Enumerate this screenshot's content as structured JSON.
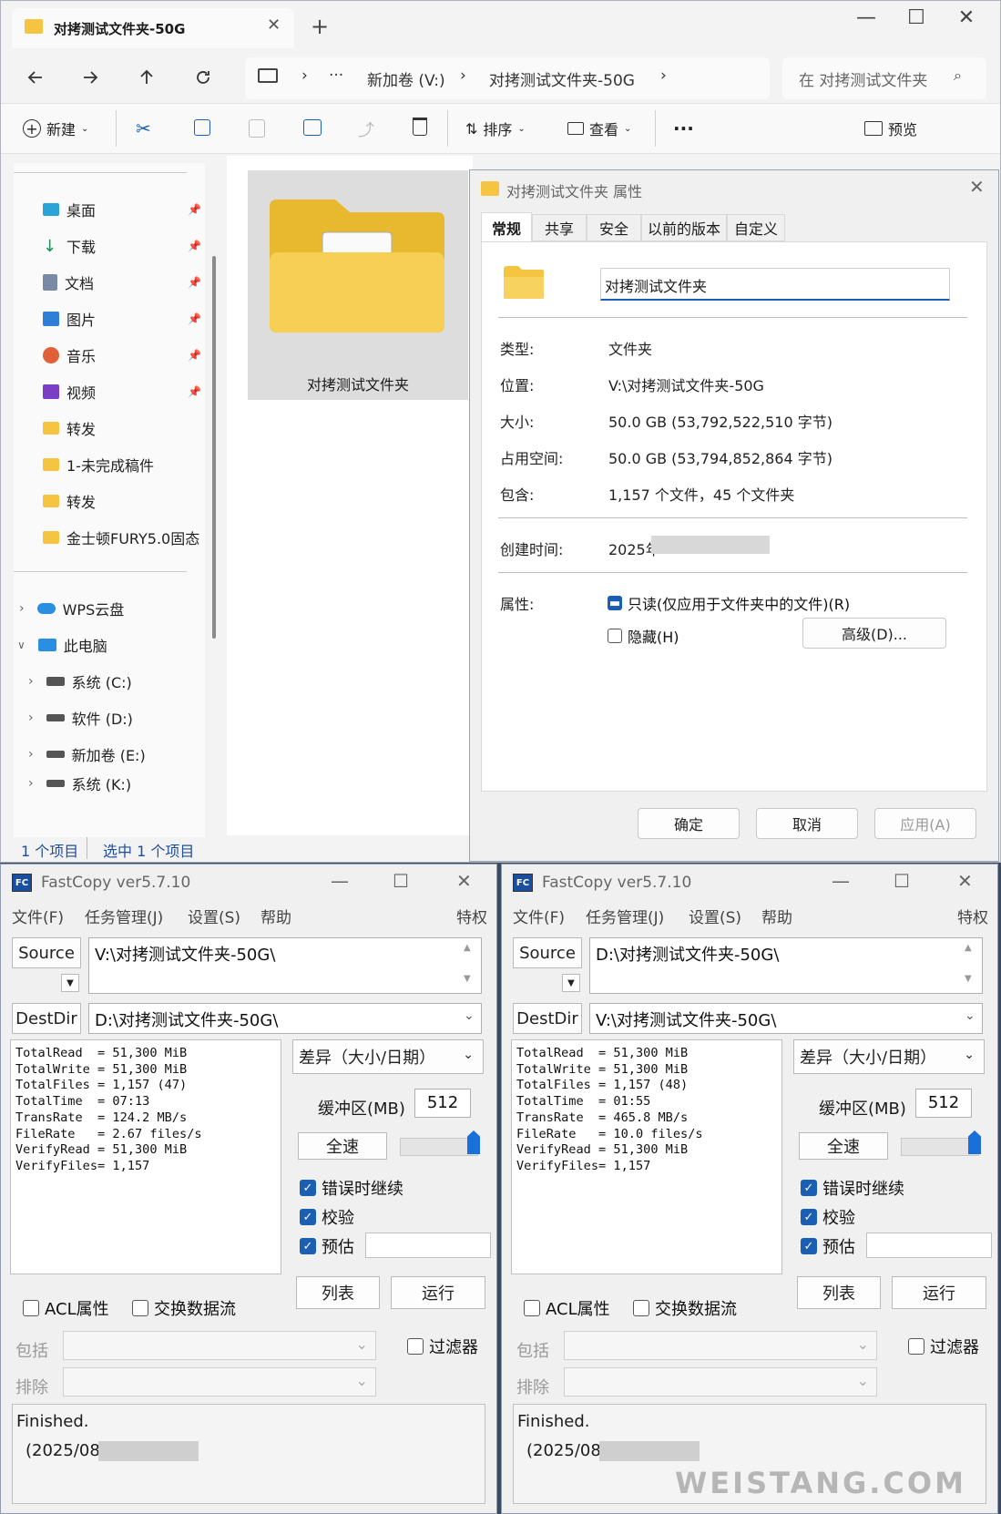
{
  "explorer": {
    "tab_title": "对拷测试文件夹-50G",
    "new_tab": "+",
    "window_controls": {
      "minimize": "—",
      "maximize": "☐",
      "close": "✕"
    },
    "breadcrumb": {
      "more": "···",
      "drive": "新加卷 (V:)",
      "folder": "对拷测试文件夹-50G"
    },
    "search_placeholder": "在 对拷测试文件夹",
    "toolbar": {
      "new": "新建",
      "sort": "排序",
      "view": "查看",
      "more": "···",
      "preview": "预览"
    },
    "sidebar": {
      "items": [
        "桌面",
        "下载",
        "文档",
        "图片",
        "音乐",
        "视频",
        "转发",
        "1-未完成稿件",
        "转发",
        "金士顿FURY5.0固态"
      ],
      "tree": [
        "WPS云盘",
        "此电脑",
        "系统 (C:)",
        "软件 (D:)",
        "新加卷 (E:)",
        "系统 (K:)"
      ]
    },
    "folder_item": "对拷测试文件夹",
    "status": {
      "count": "1 个项目",
      "selected": "选中 1 个项目"
    }
  },
  "properties": {
    "title": "对拷测试文件夹 属性",
    "tabs": [
      "常规",
      "共享",
      "安全",
      "以前的版本",
      "自定义"
    ],
    "name": "对拷测试文件夹",
    "rows": [
      {
        "label": "类型:",
        "value": "文件夹"
      },
      {
        "label": "位置:",
        "value": "V:\\对拷测试文件夹-50G"
      },
      {
        "label": "大小:",
        "value": "50.0 GB (53,792,522,510 字节)"
      },
      {
        "label": "占用空间:",
        "value": "50.0 GB (53,794,852,864 字节)"
      },
      {
        "label": "包含:",
        "value": "1,157 个文件，45 个文件夹"
      }
    ],
    "created_label": "创建时间:",
    "created_value": "2025年",
    "attr_label": "属性:",
    "readonly": "只读(仅应用于文件夹中的文件)(R)",
    "hidden": "隐藏(H)",
    "advanced": "高级(D)...",
    "ok": "确定",
    "cancel": "取消",
    "apply": "应用(A)"
  },
  "fastcopy_common": {
    "app_title": "FastCopy ver5.7.10",
    "menu": [
      "文件(F)",
      "任务管理(J)",
      "设置(S)",
      "帮助"
    ],
    "privilege": "特权",
    "source_btn": "Source",
    "destdir_btn": "DestDir",
    "mode": "差异（大小/日期）",
    "buffer_label": "缓冲区(MB)",
    "buffer_value": "512",
    "fullspeed": "全速",
    "continue_on_error": "错误时继续",
    "verify": "校验",
    "estimate": "预估",
    "list_btn": "列表",
    "run_btn": "运行",
    "acl": "ACL属性",
    "altstream": "交换数据流",
    "include": "包括",
    "exclude": "排除",
    "filter": "过滤器",
    "finished": "Finished."
  },
  "fastcopy_left": {
    "source": "V:\\对拷测试文件夹-50G\\",
    "dest": "D:\\对拷测试文件夹-50G\\",
    "stats": "TotalRead  = 51,300 MiB\nTotalWrite = 51,300 MiB\nTotalFiles = 1,157 (47)\nTotalTime  = 07:13\nTransRate  = 124.2 MB/s\nFileRate   = 2.67 files/s\nVerifyRead = 51,300 MiB\nVerifyFiles= 1,157",
    "timestamp": "(2025/08/"
  },
  "fastcopy_right": {
    "source": "D:\\对拷测试文件夹-50G\\",
    "dest": "V:\\对拷测试文件夹-50G\\",
    "stats": "TotalRead  = 51,300 MiB\nTotalWrite = 51,300 MiB\nTotalFiles = 1,157 (48)\nTotalTime  = 01:55\nTransRate  = 465.8 MB/s\nFileRate   = 10.0 files/s\nVerifyRead = 51,300 MiB\nVerifyFiles= 1,157",
    "timestamp": "(2025/08/"
  },
  "watermark": "WEISTANG.COM"
}
